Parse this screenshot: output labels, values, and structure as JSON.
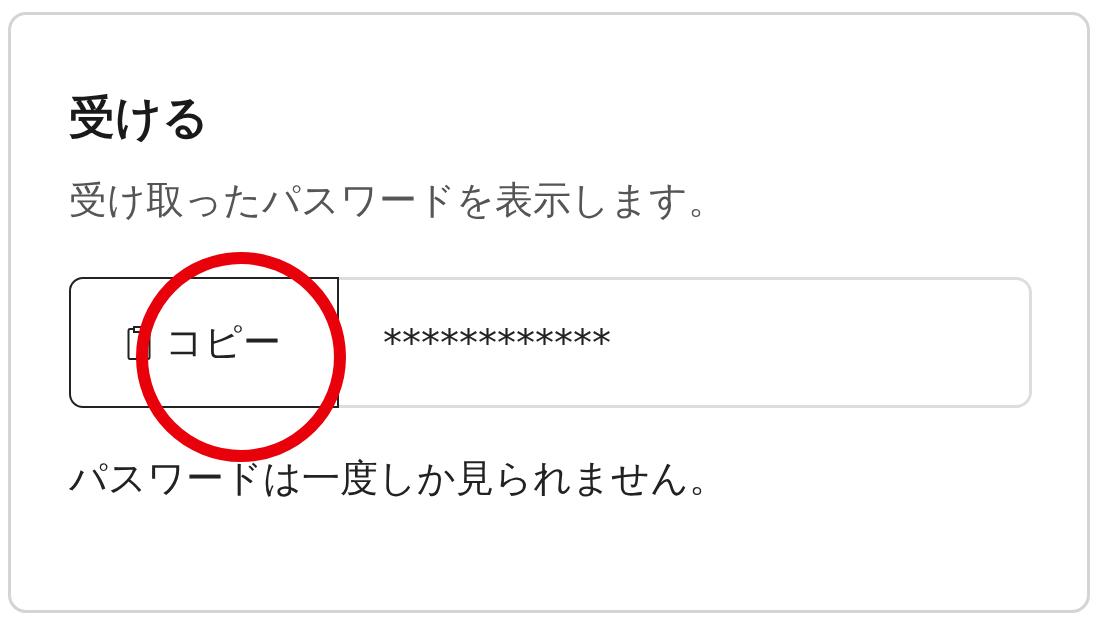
{
  "card": {
    "title": "受ける",
    "description": "受け取ったパスワードを表示します。"
  },
  "password_field": {
    "copy_button": "コピー",
    "value": "************"
  },
  "note": "パスワードは一度しか見られません。",
  "annotations": [
    {
      "kind": "circle",
      "color": "#e8000b"
    }
  ]
}
